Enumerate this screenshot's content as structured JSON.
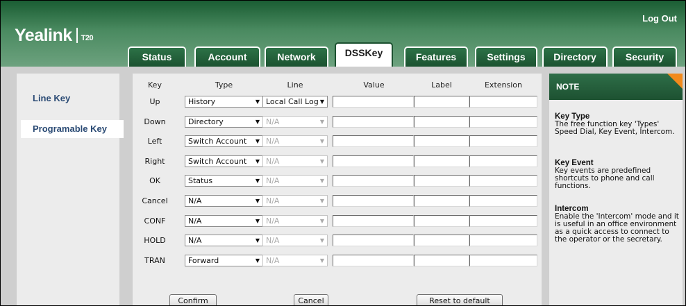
{
  "header": {
    "logo_text": "Yealink",
    "model": "T20",
    "logout_label": "Log Out"
  },
  "tabs": [
    {
      "label": "Status"
    },
    {
      "label": "Account"
    },
    {
      "label": "Network"
    },
    {
      "label": "DSSKey",
      "active": true
    },
    {
      "label": "Features"
    },
    {
      "label": "Settings"
    },
    {
      "label": "Directory"
    },
    {
      "label": "Security"
    }
  ],
  "sidebar": {
    "items": [
      {
        "label": "Line Key"
      },
      {
        "label": "Programable Key",
        "selected": true
      }
    ]
  },
  "table": {
    "columns": [
      "Key",
      "Type",
      "Line",
      "Value",
      "Label",
      "Extension"
    ],
    "rows": [
      {
        "key": "Up",
        "type": "History",
        "line": "Local Call Log",
        "line_enabled": true
      },
      {
        "key": "Down",
        "type": "Directory",
        "line": "N/A",
        "line_enabled": false
      },
      {
        "key": "Left",
        "type": "Switch Account",
        "line": "N/A",
        "line_enabled": false
      },
      {
        "key": "Right",
        "type": "Switch Account",
        "line": "N/A",
        "line_enabled": false
      },
      {
        "key": "OK",
        "type": "Status",
        "line": "N/A",
        "line_enabled": false
      },
      {
        "key": "Cancel",
        "type": "N/A",
        "line": "N/A",
        "line_enabled": false
      },
      {
        "key": "CONF",
        "type": "N/A",
        "line": "N/A",
        "line_enabled": false
      },
      {
        "key": "HOLD",
        "type": "N/A",
        "line": "N/A",
        "line_enabled": false
      },
      {
        "key": "TRAN",
        "type": "Forward",
        "line": "N/A",
        "line_enabled": false
      }
    ]
  },
  "buttons": {
    "confirm": "Confirm",
    "cancel": "Cancel",
    "reset": "Reset to default"
  },
  "note": {
    "title": "NOTE",
    "sections": [
      {
        "heading": "Key Type",
        "body": "The free function key 'Types' Speed Dial, Key Event, Intercom."
      },
      {
        "heading": "Key Event",
        "body": "Key events are predefined shortcuts to phone and call functions."
      },
      {
        "heading": "Intercom",
        "body": "Enable the 'Intercom' mode and it is useful in an office environment as a quick access to connect to the operator or the secretary."
      }
    ]
  },
  "colors": {
    "header_green": "#1a5d33",
    "note_accent": "#f28a1c",
    "sidebar_link": "#2a4a74"
  }
}
